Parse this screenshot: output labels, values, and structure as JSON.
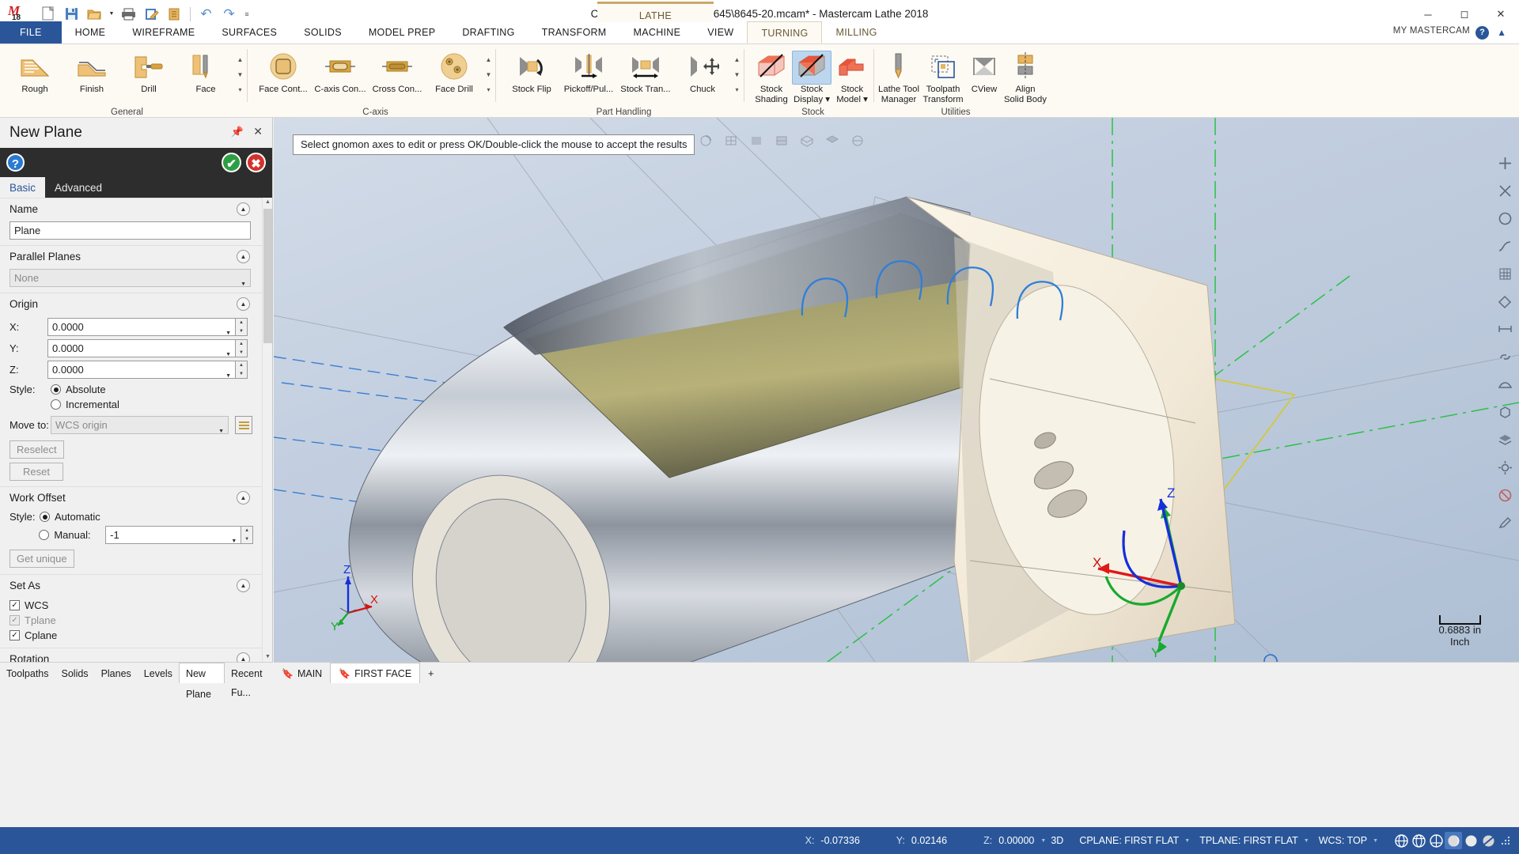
{
  "titlebar": {
    "logo_letter": "M",
    "logo_year": "18",
    "document_title": "C:\\Users\\Charlie\\Videos\\8645\\8645-20.mcam* - Mastercam Lathe 2018",
    "context_tab": "LATHE",
    "quick_access": [
      {
        "name": "new-file-icon",
        "glyph": "⬜"
      },
      {
        "name": "save-icon",
        "glyph": "💾"
      },
      {
        "name": "open-folder-icon",
        "glyph": "📂"
      },
      {
        "name": "open-dropdown-icon",
        "glyph": "▾"
      },
      {
        "name": "print-icon",
        "glyph": "🖨"
      },
      {
        "name": "edit-note-icon",
        "glyph": "📝"
      },
      {
        "name": "clipboard-icon",
        "glyph": "📋"
      },
      {
        "name": "undo-icon",
        "glyph": "↶"
      },
      {
        "name": "redo-icon",
        "glyph": "↷"
      },
      {
        "name": "customize-qat-icon",
        "glyph": "☰"
      }
    ],
    "window_buttons": [
      {
        "name": "minimize-button",
        "glyph": "─"
      },
      {
        "name": "maximize-button",
        "glyph": "□"
      },
      {
        "name": "close-button",
        "glyph": "✕"
      }
    ]
  },
  "ribbon_tabs": {
    "file": "FILE",
    "items": [
      "HOME",
      "WIREFRAME",
      "SURFACES",
      "SOLIDS",
      "MODEL PREP",
      "DRAFTING",
      "TRANSFORM",
      "MACHINE",
      "VIEW"
    ],
    "context_items": [
      "TURNING",
      "MILLING"
    ],
    "active": "TURNING",
    "my_mastercam": "MY MASTERCAM"
  },
  "ribbon": {
    "groups": [
      {
        "label": "General",
        "items": [
          {
            "label": "Rough",
            "icon": "rough-toolpath-icon"
          },
          {
            "label": "Finish",
            "icon": "finish-toolpath-icon"
          },
          {
            "label": "Drill",
            "icon": "drill-toolpath-icon"
          },
          {
            "label": "Face",
            "icon": "face-toolpath-icon"
          }
        ]
      },
      {
        "label": "C-axis",
        "items": [
          {
            "label": "Face Cont...",
            "icon": "face-contour-icon"
          },
          {
            "label": "C-axis Con...",
            "icon": "c-axis-contour-icon"
          },
          {
            "label": "Cross Con...",
            "icon": "cross-contour-icon"
          },
          {
            "label": "Face Drill",
            "icon": "face-drill-icon"
          }
        ]
      },
      {
        "label": "Part Handling",
        "items": [
          {
            "label": "Stock Flip",
            "icon": "stock-flip-icon"
          },
          {
            "label": "Pickoff/Pul...",
            "icon": "pickoff-pull-icon"
          },
          {
            "label": "Stock Tran...",
            "icon": "stock-transfer-icon"
          },
          {
            "label": "Chuck",
            "icon": "chuck-icon"
          }
        ]
      },
      {
        "label": "Stock",
        "items": [
          {
            "label": "Stock\nShading",
            "icon": "stock-shading-icon",
            "selected": false
          },
          {
            "label": "Stock\nDisplay ▾",
            "icon": "stock-display-icon",
            "selected": true
          },
          {
            "label": "Stock\nModel ▾",
            "icon": "stock-model-icon",
            "selected": false
          }
        ]
      },
      {
        "label": "Utilities",
        "items": [
          {
            "label": "Lathe Tool\nManager",
            "icon": "lathe-tool-manager-icon"
          },
          {
            "label": "Toolpath\nTransform",
            "icon": "toolpath-transform-icon"
          },
          {
            "label": "CView",
            "icon": "cview-icon"
          },
          {
            "label": "Align\nSolid Body",
            "icon": "align-solid-body-icon"
          }
        ]
      }
    ]
  },
  "panel": {
    "title": "New Plane",
    "tabs": [
      "Basic",
      "Advanced"
    ],
    "active_tab": "Basic",
    "help_glyph": "?",
    "ok_glyph": "✔",
    "cancel_glyph": "✖",
    "pin_glyph": "📌",
    "close_glyph": "✕",
    "sections": {
      "name": {
        "header": "Name",
        "value": "Plane"
      },
      "parallel_planes": {
        "header": "Parallel Planes",
        "value": "None"
      },
      "origin": {
        "header": "Origin",
        "x_label": "X:",
        "x_value": "0.0000",
        "y_label": "Y:",
        "y_value": "0.0000",
        "z_label": "Z:",
        "z_value": "0.0000",
        "style_label": "Style:",
        "style_absolute": "Absolute",
        "style_incremental": "Incremental",
        "style_selected": "Absolute",
        "move_to_label": "Move to:",
        "move_to_value": "WCS origin",
        "reselect_button": "Reselect",
        "reset_button": "Reset"
      },
      "work_offset": {
        "header": "Work Offset",
        "style_label": "Style:",
        "automatic": "Automatic",
        "manual": "Manual:",
        "manual_value": "-1",
        "selected": "Automatic",
        "get_unique_button": "Get unique"
      },
      "set_as": {
        "header": "Set As",
        "items": [
          {
            "label": "WCS",
            "checked": true,
            "enabled": true
          },
          {
            "label": "Tplane",
            "checked": true,
            "enabled": false
          },
          {
            "label": "Cplane",
            "checked": true,
            "enabled": true
          }
        ]
      },
      "rotation": {
        "header": "Rotation"
      }
    },
    "bottom_tabs": [
      "Toolpaths",
      "Solids",
      "Planes",
      "Levels",
      "New Plane",
      "Recent Fu..."
    ],
    "bottom_active": "New Plane"
  },
  "viewport": {
    "prompt": "Select gnomon axes to edit or press OK/Double-click the mouse to accept the results",
    "gnomon_labels": {
      "x": "X",
      "y": "Y",
      "z": "Z"
    },
    "view_axes_labels": {
      "x": "X",
      "y": "Y",
      "z": "Z"
    },
    "scale_value": "0.6883 in",
    "scale_unit": "Inch",
    "toolbar_icons": [
      "fit-icon",
      "zoom-window-icon",
      "zoom-target-icon",
      "unzoom-icon",
      "pan-icon",
      "dynamic-rotate-icon",
      "wireframe-icon",
      "shaded-icon",
      "wireframe-shade-icon",
      "isometric-icon",
      "top-view-icon",
      "front-view-icon"
    ],
    "rail_icons": [
      "add-view-icon",
      "cut-icon",
      "circle-icon",
      "curve-icon",
      "grid-icon",
      "analyze-icon",
      "measure-icon",
      "chain-icon",
      "surface-icon",
      "solid-icon",
      "layers-icon",
      "settings-icon",
      "blocked-icon",
      "pencil-icon"
    ]
  },
  "sheet_tabs": {
    "items": [
      {
        "label": "MAIN",
        "active": false
      },
      {
        "label": "FIRST FACE",
        "active": true
      }
    ],
    "add_label": "+"
  },
  "statusbar": {
    "x_label": "X:",
    "x_value": "-0.07336",
    "y_label": "Y:",
    "y_value": "0.02146",
    "z_label": "Z:",
    "z_value": "0.00000",
    "dim_mode": "3D",
    "cplane": "CPLANE: FIRST FLAT",
    "tplane": "TPLANE: FIRST FLAT",
    "wcs": "WCS: TOP",
    "view_icons": [
      "globe-wire-icon",
      "globe-iso-icon",
      "globe-half-icon",
      "shade-sphere-icon",
      "shade-solid-icon",
      "shade-half-icon",
      "resize-grip-icon"
    ]
  },
  "colors": {
    "accent_blue": "#2a5699",
    "ribbon_bg": "#fdfaf4",
    "context_gold": "#c9a86a",
    "ok_green": "#2e9e44",
    "cancel_red": "#d2332c",
    "icon_gold": "#e8b460",
    "icon_gray": "#8e8e8e",
    "stock_red": "#e8604c"
  }
}
